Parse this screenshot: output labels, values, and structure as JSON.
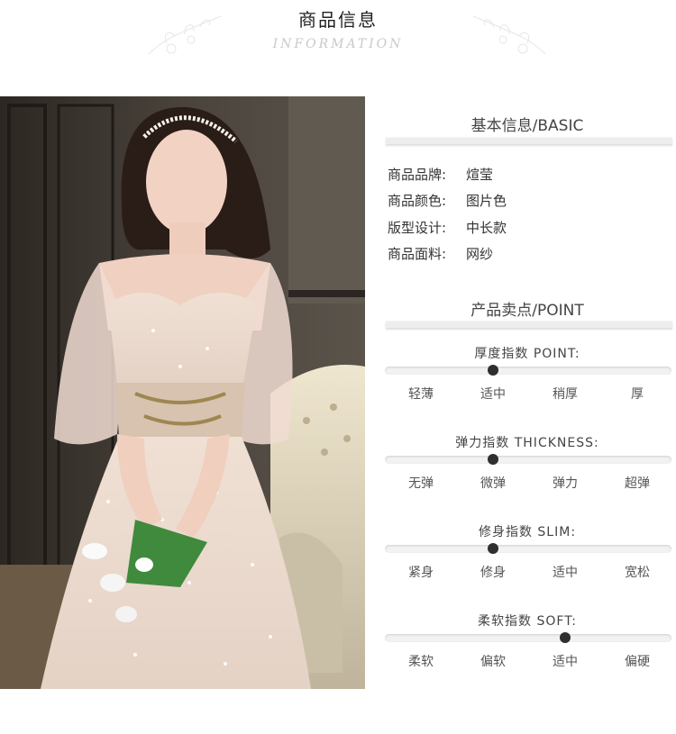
{
  "header": {
    "title": "商品信息",
    "subtitle": "INFORMATION"
  },
  "basic": {
    "title": "基本信息/BASIC",
    "rows": [
      {
        "key": "商品品牌:",
        "value": "煊莹"
      },
      {
        "key": "商品颜色:",
        "value": "图片色"
      },
      {
        "key": "版型设计:",
        "value": "中长款"
      },
      {
        "key": "商品面料:",
        "value": "网纱"
      }
    ]
  },
  "point": {
    "title": "产品卖点/POINT",
    "indices": [
      {
        "title": "厚度指数  POINT:",
        "labels": [
          "轻薄",
          "适中",
          "稍厚",
          "厚"
        ],
        "selected": 1
      },
      {
        "title": "弹力指数  THICKNESS:",
        "labels": [
          "无弹",
          "微弹",
          "弹力",
          "超弹"
        ],
        "selected": 1
      },
      {
        "title": "修身指数  SLIM:",
        "labels": [
          "紧身",
          "修身",
          "适中",
          "宽松"
        ],
        "selected": 1
      },
      {
        "title": "柔软指数  SOFT:",
        "labels": [
          "柔软",
          "偏软",
          "适中",
          "偏硬"
        ],
        "selected": 2
      }
    ]
  },
  "colors": {
    "track": "#f2f2f2",
    "dot": "#2f2f2f",
    "dress": "#ead8cc"
  }
}
